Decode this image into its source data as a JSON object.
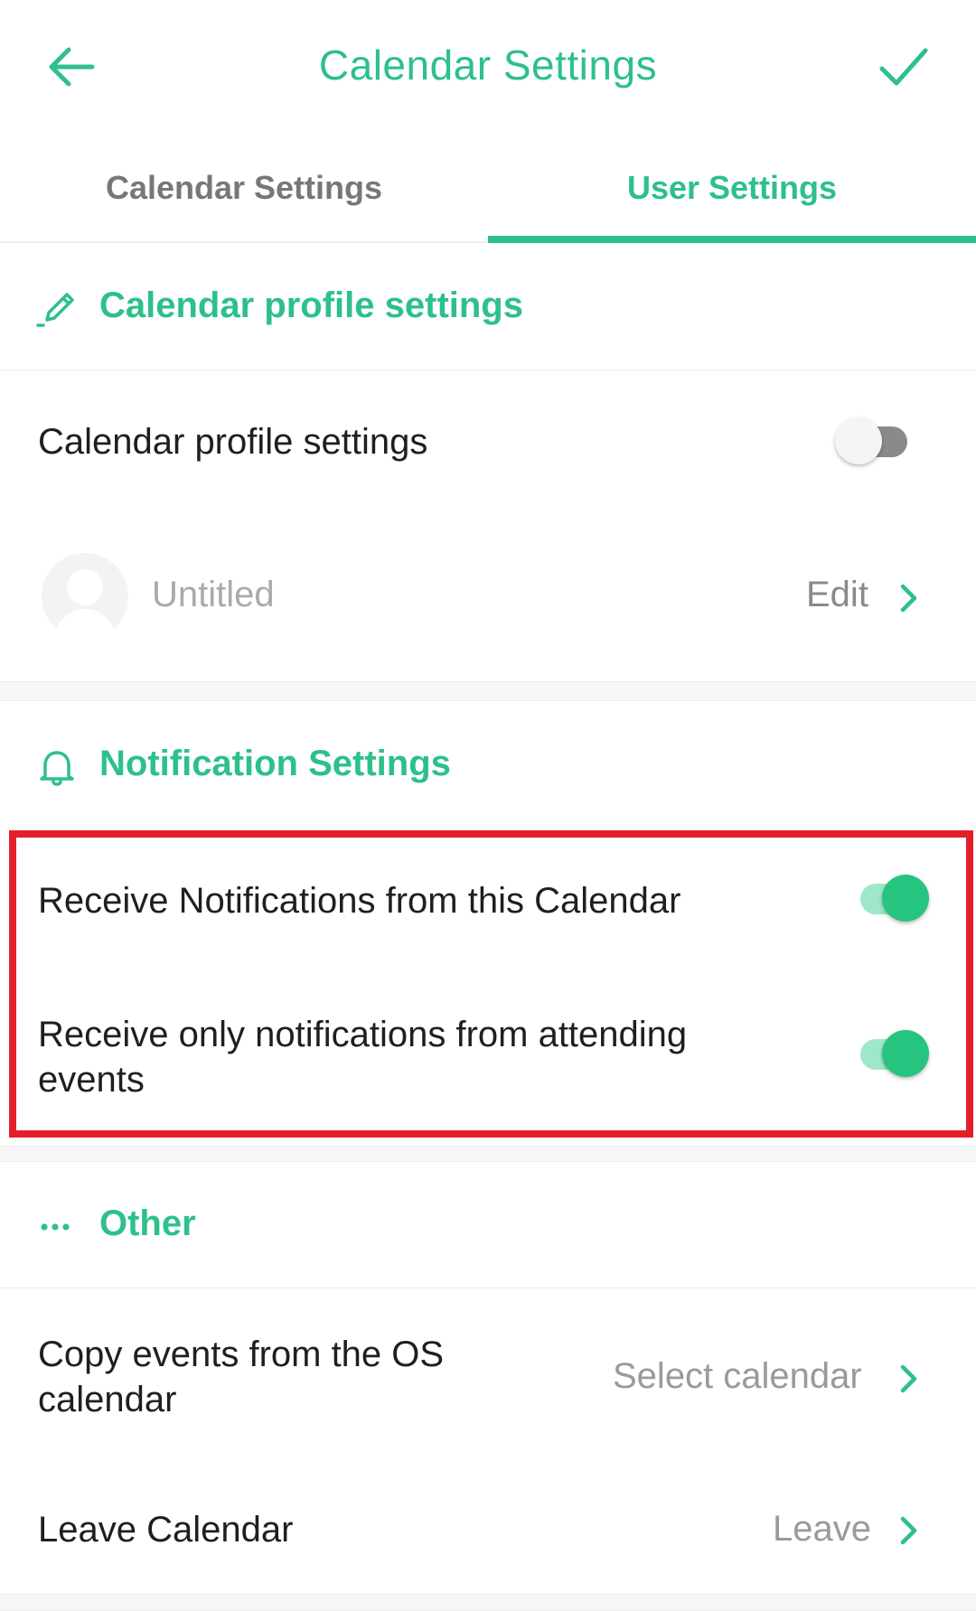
{
  "header": {
    "title": "Calendar Settings",
    "back_icon": "arrow-left-icon",
    "confirm_icon": "checkmark-icon"
  },
  "tabs": [
    {
      "label": "Calendar Settings",
      "active": false
    },
    {
      "label": "User Settings",
      "active": true
    }
  ],
  "profile_section": {
    "header": "Calendar profile settings",
    "icon": "pencil-icon",
    "toggle_row": {
      "label": "Calendar profile settings",
      "enabled": false
    },
    "profile_row": {
      "name": "Untitled",
      "action": "Edit"
    }
  },
  "notification_section": {
    "header": "Notification Settings",
    "icon": "bell-icon",
    "rows": [
      {
        "label": "Receive Notifications from this Calendar",
        "enabled": true
      },
      {
        "label_line1": "Receive only notifications from attending",
        "label_line2": "events",
        "enabled": true
      }
    ]
  },
  "other_section": {
    "header": "Other",
    "icon": "more-dots-icon",
    "rows": [
      {
        "label_line1": "Copy events from the OS",
        "label_line2": "calendar",
        "value": "Select calendar"
      },
      {
        "label": "Leave Calendar",
        "value": "Leave"
      }
    ]
  },
  "colors": {
    "accent": "#2dc08a",
    "highlight_border": "#e3202a"
  }
}
